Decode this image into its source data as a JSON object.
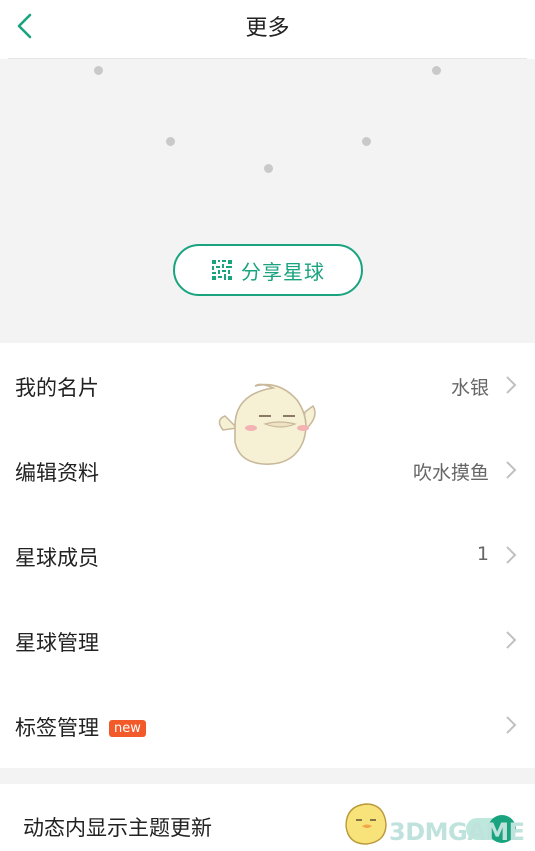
{
  "header": {
    "title": "更多",
    "back_icon": "chevron-left-icon"
  },
  "share": {
    "label": "分享星球",
    "icon": "qr-code-icon"
  },
  "colors": {
    "accent": "#1aa37f",
    "badge": "#f25a29",
    "section_bg": "#f3f3f3"
  },
  "list": [
    {
      "label": "我的名片",
      "value": "水银"
    },
    {
      "label": "编辑资料",
      "value": "吹水摸鱼"
    },
    {
      "label": "星球成员",
      "value": "1"
    },
    {
      "label": "星球管理",
      "value": ""
    },
    {
      "label": "标签管理",
      "value": "",
      "badge": "new"
    }
  ],
  "feed_setting": {
    "label": "动态内显示主题更新",
    "enabled": true
  },
  "watermark": "3DMGAME"
}
